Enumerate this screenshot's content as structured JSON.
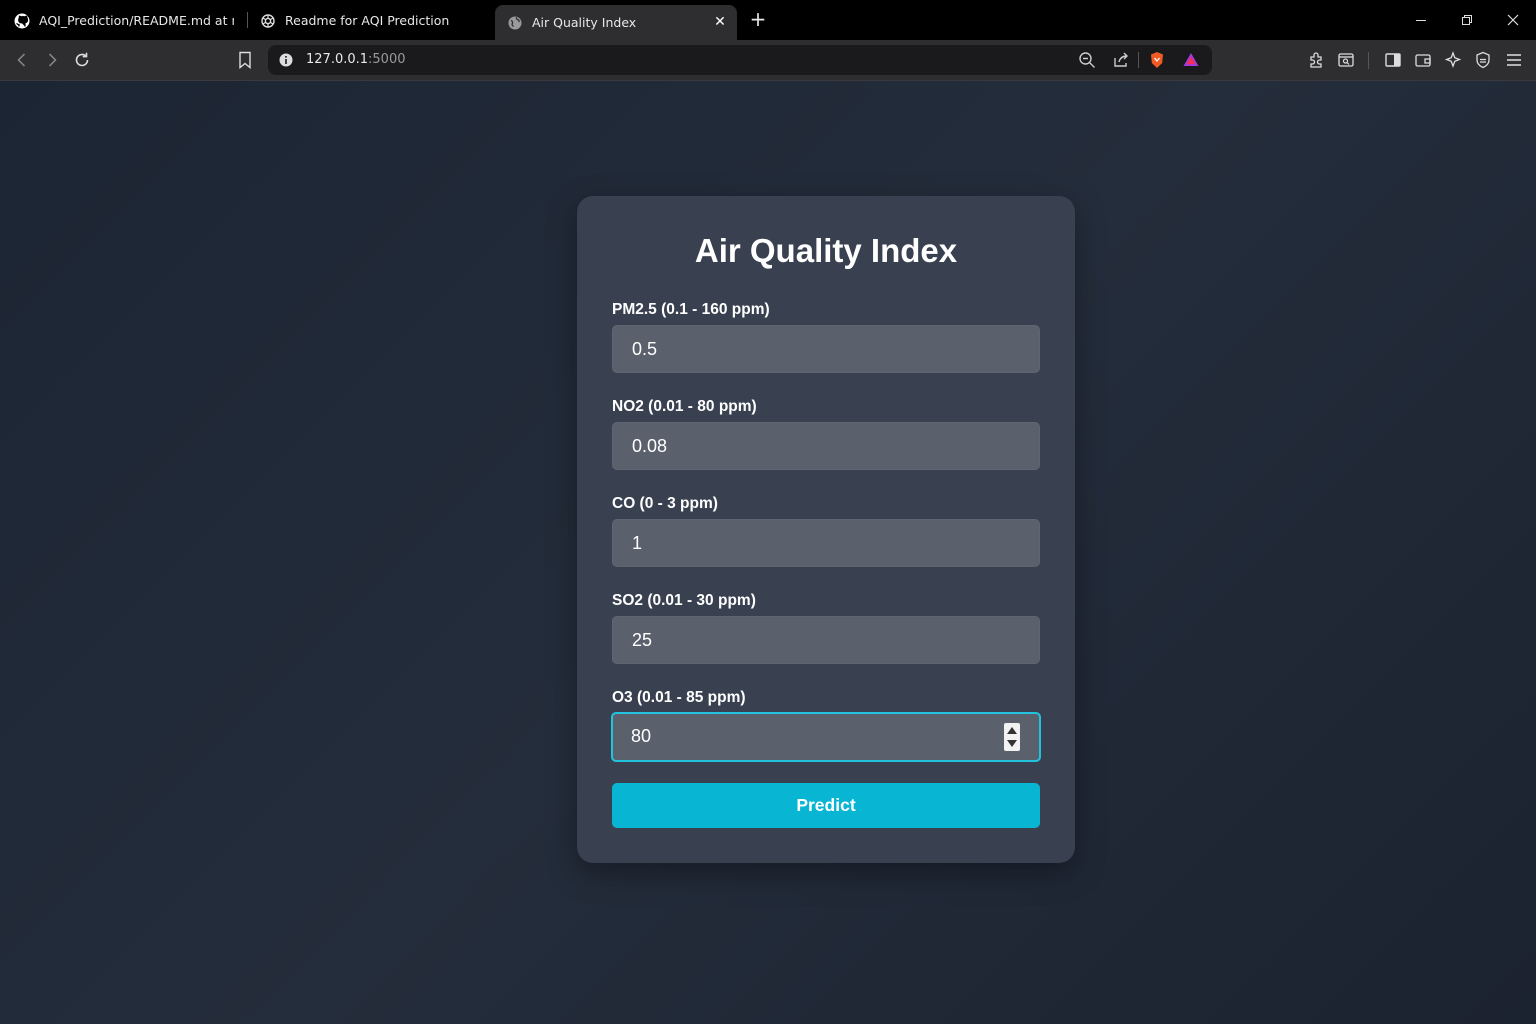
{
  "browser": {
    "tabs": [
      {
        "title": "AQI_Prediction/README.md at main",
        "icon": "github-icon"
      },
      {
        "title": "Readme for AQI Prediction",
        "icon": "chatgpt-icon"
      },
      {
        "title": "Air Quality Index",
        "icon": "globe-icon",
        "active": true
      }
    ],
    "address": {
      "host": "127.0.0.1",
      "port": ":5000"
    }
  },
  "form": {
    "title": "Air Quality Index",
    "fields": [
      {
        "label": "PM2.5 (0.1 - 160 ppm)",
        "value": "0.5"
      },
      {
        "label": "NO2 (0.01 - 80 ppm)",
        "value": "0.08"
      },
      {
        "label": "CO (0 - 3 ppm)",
        "value": "1"
      },
      {
        "label": "SO2 (0.01 - 30 ppm)",
        "value": "25"
      },
      {
        "label": "O3 (0.01 - 85 ppm)",
        "value": "80"
      }
    ],
    "submit_label": "Predict"
  },
  "colors": {
    "accent": "#08b6d4",
    "focus_border": "#22c3de",
    "card": "#394150",
    "input": "#5a616d"
  }
}
